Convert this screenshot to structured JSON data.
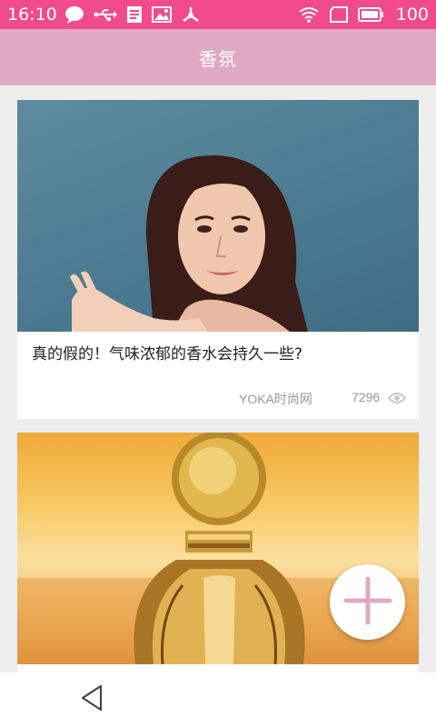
{
  "status_bar": {
    "time": "16:10",
    "battery": "100",
    "icons": [
      "chat-bubble-icon",
      "usb-icon",
      "document-icon",
      "image-icon",
      "usb-debug-icon",
      "wifi-icon",
      "sim-icon",
      "battery-icon"
    ]
  },
  "app_bar": {
    "title": "香氛"
  },
  "cards": [
    {
      "title": "真的假的！气味浓郁的香水会持久一些?",
      "source": "YOKA时尚网",
      "views": "7296",
      "image": "woman-portrait-image"
    },
    {
      "image": "perfume-bottle-image"
    }
  ],
  "fab": {
    "icon": "plus-icon"
  },
  "nav_bar": {
    "back_icon": "back-triangle-icon"
  },
  "colors": {
    "status_bar": "#f24b8c",
    "app_bar": "#e0a9c3",
    "accent": "#e0a9c3",
    "background": "#eeeeee"
  }
}
